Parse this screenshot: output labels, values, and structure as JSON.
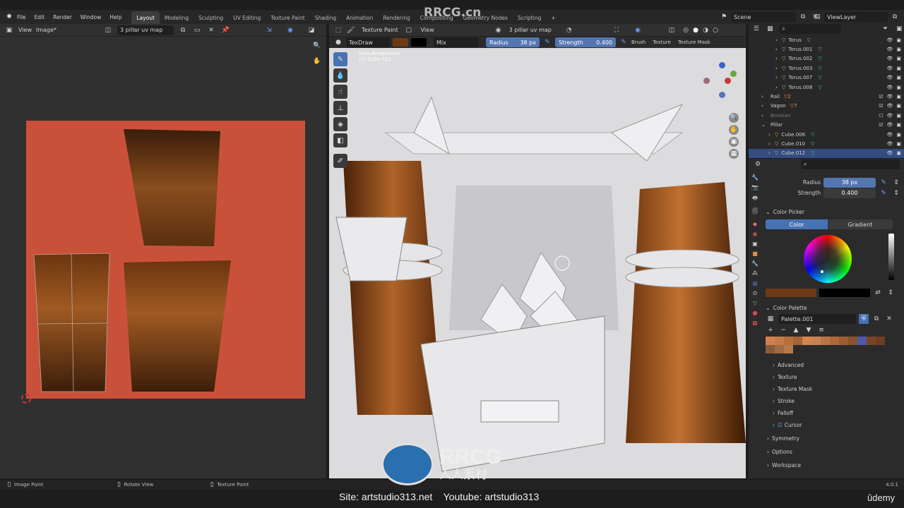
{
  "topbar": {
    "menu": [
      "File",
      "Edit",
      "Render",
      "Window",
      "Help"
    ],
    "workspaces": [
      "Layout",
      "Modeling",
      "Sculpting",
      "UV Editing",
      "Texture Paint",
      "Shading",
      "Animation",
      "Rendering",
      "Compositing",
      "Geometry Nodes",
      "Scripting"
    ],
    "active_workspace": "Layout",
    "add_tab": "+",
    "scene": "Scene",
    "view_layer": "ViewLayer"
  },
  "image_editor": {
    "view_menu": "View",
    "image_menu": "Image*",
    "uv_map": "3 pillar uv map",
    "bg_color": "#c9513a"
  },
  "viewport": {
    "mode": "Texture Paint",
    "view_menu": "View",
    "uv_map": "3 pillar uv map",
    "brush_name": "TexDraw",
    "blend": "Mix",
    "radius_label": "Radius",
    "radius_value": "38 px",
    "strength_label": "Strength",
    "strength_value": "0.400",
    "brush_menu": "Brush",
    "texture_menu": "Texture",
    "texture_mask_menu": "Texture Mask",
    "overlay_title": "User Perspective",
    "overlay_object": "(1) Cube.012"
  },
  "outliner": {
    "rows": [
      {
        "name": "Torus",
        "indent": 3,
        "type": "mesh"
      },
      {
        "name": "Torus.001",
        "indent": 3,
        "type": "mesh"
      },
      {
        "name": "Torus.002",
        "indent": 3,
        "type": "mesh"
      },
      {
        "name": "Torus.003",
        "indent": 3,
        "type": "mesh"
      },
      {
        "name": "Torus.007",
        "indent": 3,
        "type": "mesh"
      },
      {
        "name": "Torus.008",
        "indent": 3,
        "type": "mesh"
      },
      {
        "name": "Rail",
        "indent": 1,
        "type": "collection",
        "badge": "2"
      },
      {
        "name": "Vagon",
        "indent": 1,
        "type": "collection",
        "badge": "7"
      },
      {
        "name": "Boolean",
        "indent": 1,
        "type": "collection",
        "dim": true
      },
      {
        "name": "Pillar",
        "indent": 1,
        "type": "collection"
      },
      {
        "name": "Cube.006",
        "indent": 2,
        "type": "mesh"
      },
      {
        "name": "Cube.010",
        "indent": 2,
        "type": "mesh"
      },
      {
        "name": "Cube.012",
        "indent": 2,
        "type": "mesh",
        "selected": true
      }
    ]
  },
  "properties": {
    "radius_label": "Radius",
    "radius_value": "38 px",
    "strength_label": "Strength",
    "strength_value": "0.400",
    "color_picker_label": "Color Picker",
    "color_tab": "Color",
    "gradient_tab": "Gradient",
    "color_palette_label": "Color Palette",
    "palette_name": "Palette.001",
    "palette_colors": [
      "#d2804c",
      "#c67a45",
      "#b96f3d",
      "#a86436",
      "#d28650",
      "#c88250",
      "#bb7544",
      "#ad693a",
      "#9c5d33",
      "#8c522c",
      "#4e5aa8",
      "#7a4526",
      "#6e3e22",
      "#8a5a3c",
      "#a06a44",
      "#b47a4e"
    ],
    "primary_color": "#6e3a16",
    "secondary_color": "#000000",
    "sections": [
      "Advanced",
      "Texture",
      "Texture Mask",
      "Stroke",
      "Falloff",
      "Cursor"
    ],
    "top_sections": [
      "Symmetry",
      "Options",
      "Workspace"
    ]
  },
  "statusbar": {
    "left": "Image Paint",
    "mid": "Rotate View",
    "right": "Texture Paint",
    "version": "4.0.1"
  },
  "watermark": {
    "top": "RRCG.cn",
    "footer": "Site: artstudio313.net    Youtube: artstudio313",
    "logo_text": "RRCG",
    "logo_sub": "人人素材",
    "udemy": "ûdemy"
  }
}
